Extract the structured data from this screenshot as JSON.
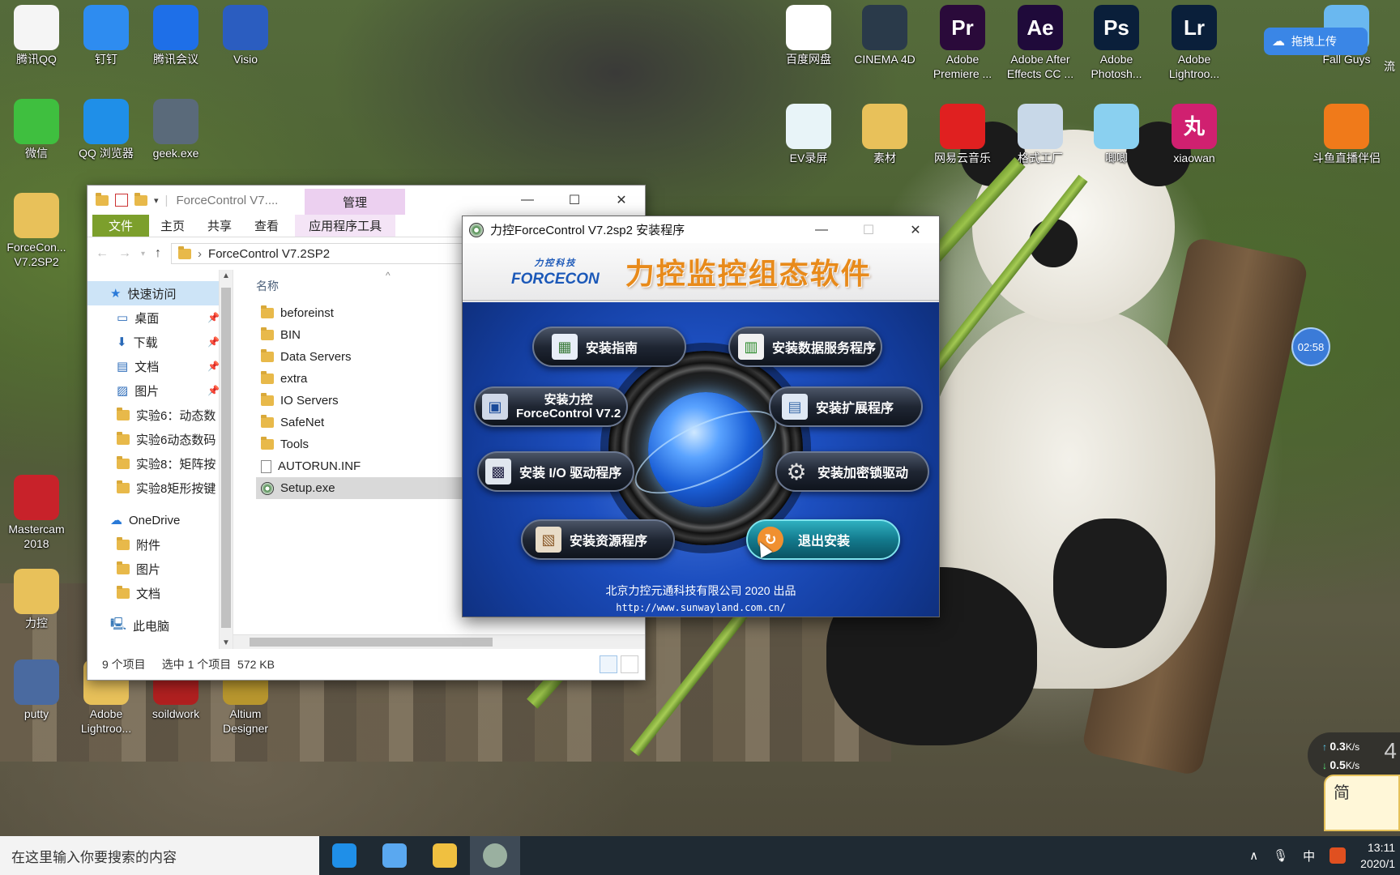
{
  "desktop": {
    "left_icons": [
      {
        "label": "腾讯QQ",
        "icon": "qq-icon",
        "color": "#f5f5f5"
      },
      {
        "label": "钉钉",
        "icon": "dingtalk-icon",
        "color": "#2e8cf0"
      },
      {
        "label": "腾讯会议",
        "icon": "tencent-meeting-icon",
        "color": "#1e6fe8"
      },
      {
        "label": "Visio",
        "icon": "visio-icon",
        "color": "#2b5dc0"
      },
      {
        "label": "微信",
        "icon": "wechat-icon",
        "color": "#3fbf3f"
      },
      {
        "label": "QQ 浏览器",
        "icon": "qq-browser-icon",
        "color": "#1f8fe8"
      },
      {
        "label": "geek.exe",
        "icon": "geek-icon",
        "color": "#5a6a7a"
      },
      {
        "label": "ForceCon... V7.2SP2",
        "icon": "folder-icon",
        "color": "#e8c15a"
      },
      {
        "label": "Mastercam 2018",
        "icon": "mastercam-icon",
        "color": "#c8222a"
      },
      {
        "label": "力控",
        "icon": "folder-icon",
        "color": "#e8c15a"
      },
      {
        "label": "putty",
        "icon": "putty-icon",
        "color": "#4a6aa0"
      },
      {
        "label": "Adobe Lightroo...",
        "icon": "folder-icon",
        "color": "#e8c15a"
      },
      {
        "label": "soildwork",
        "icon": "solidworks-icon",
        "color": "#b02020"
      },
      {
        "label": "Altium Designer",
        "icon": "altium-icon",
        "color": "#b8962e"
      }
    ],
    "top_icons": [
      {
        "label": "百度网盘",
        "icon": "baidu-netdisk-icon",
        "color": "#ffffff"
      },
      {
        "label": "CINEMA 4D",
        "icon": "cinema4d-icon",
        "color": "#2a3a4a"
      },
      {
        "label": "Adobe Premiere ...",
        "icon": "premiere-icon",
        "color": "#2a0a3a",
        "glyph": "Pr"
      },
      {
        "label": "Adobe After Effects CC ...",
        "icon": "after-effects-icon",
        "color": "#1f0a3a",
        "glyph": "Ae"
      },
      {
        "label": "Adobe Photosh...",
        "icon": "photoshop-icon",
        "color": "#0a1f3a",
        "glyph": "Ps"
      },
      {
        "label": "Adobe Lightroo...",
        "icon": "lightroom-icon",
        "color": "#0a1f3a",
        "glyph": "Lr"
      },
      {
        "label": "Fall Guys",
        "icon": "fall-guys-icon",
        "color": "#6ab8f0"
      },
      {
        "label": "EV录屏",
        "icon": "ev-recorder-icon",
        "color": "#e8f4f8"
      },
      {
        "label": "素材",
        "icon": "folder-icon",
        "color": "#e8c15a"
      },
      {
        "label": "网易云音乐",
        "icon": "netease-music-icon",
        "color": "#e02020"
      },
      {
        "label": "格式工厂",
        "icon": "format-factory-icon",
        "color": "#c8d8e8"
      },
      {
        "label": "唧唧",
        "icon": "jiji-icon",
        "color": "#8ad0f0"
      },
      {
        "label": "xiaowan",
        "icon": "xiaowan-icon",
        "color": "#d02070",
        "glyph": "丸"
      },
      {
        "label": "斗鱼直播伴侣",
        "icon": "douyu-icon",
        "color": "#f07a1a"
      }
    ],
    "partial_label": "流"
  },
  "explorer": {
    "title": "ForceControl V7....",
    "manage_tab": "管理",
    "ribbon_tabs": [
      "文件",
      "主页",
      "共享",
      "查看",
      "应用程序工具"
    ],
    "address": "ForceControl V7.2SP2",
    "nav": {
      "quick_access": "快速访问",
      "items": [
        "桌面",
        "下载",
        "文档",
        "图片",
        "实验6：动态数",
        "实验6动态数码",
        "实验8：矩阵按",
        "实验8矩形按键"
      ],
      "onedrive": "OneDrive",
      "onedrive_items": [
        "附件",
        "图片",
        "文档"
      ],
      "this_pc": "此电脑"
    },
    "column_header": "名称",
    "files": [
      {
        "name": "beforeinst",
        "type": "folder"
      },
      {
        "name": "BIN",
        "type": "folder"
      },
      {
        "name": "Data Servers",
        "type": "folder"
      },
      {
        "name": "extra",
        "type": "folder"
      },
      {
        "name": "IO Servers",
        "type": "folder"
      },
      {
        "name": "SafeNet",
        "type": "folder"
      },
      {
        "name": "Tools",
        "type": "folder"
      },
      {
        "name": "AUTORUN.INF",
        "type": "file"
      },
      {
        "name": "Setup.exe",
        "type": "exe",
        "selected": true
      }
    ],
    "status": {
      "count": "9 个项目",
      "selected": "选中 1 个项目",
      "size": "572 KB"
    }
  },
  "installer": {
    "title": "力控ForceControl V7.2sp2 安装程序",
    "brand_cn": "力控科技",
    "brand_en": "FORCECON",
    "header_title": "力控监控组态软件",
    "buttons": {
      "guide": "安装指南",
      "data_service": "安装数据服务程序",
      "forcecontrol_line1": "安装力控",
      "forcecontrol_line2": "ForceControl V7.2",
      "extension": "安装扩展程序",
      "io_driver": "安装 I/O 驱动程序",
      "dongle": "安装加密锁驱动",
      "resource": "安装资源程序",
      "exit": "退出安装"
    },
    "footer": "北京力控元通科技有限公司 2020 出品",
    "url": "http://www.sunwayland.com.cn/"
  },
  "widgets": {
    "upload_label": "拖拽上传",
    "timer": "02:58",
    "net_up": "0.3",
    "net_down": "0.5",
    "net_unit": "K/s",
    "net_side": "4",
    "ime_label": "简"
  },
  "taskbar": {
    "search_placeholder": "在这里输入你要搜索的内容",
    "apps": [
      {
        "name": "qq-browser-task-icon",
        "color": "#1f8fe8"
      },
      {
        "name": "baidu-netdisk-task-icon",
        "color": "#5aa8f0"
      },
      {
        "name": "file-explorer-task-icon",
        "color": "#f0c040"
      },
      {
        "name": "setup-task-icon",
        "color": "#9ab0a0"
      }
    ],
    "tray": {
      "chevron": "∧",
      "ime": "中",
      "time": "13:11",
      "date": "2020/1"
    }
  }
}
